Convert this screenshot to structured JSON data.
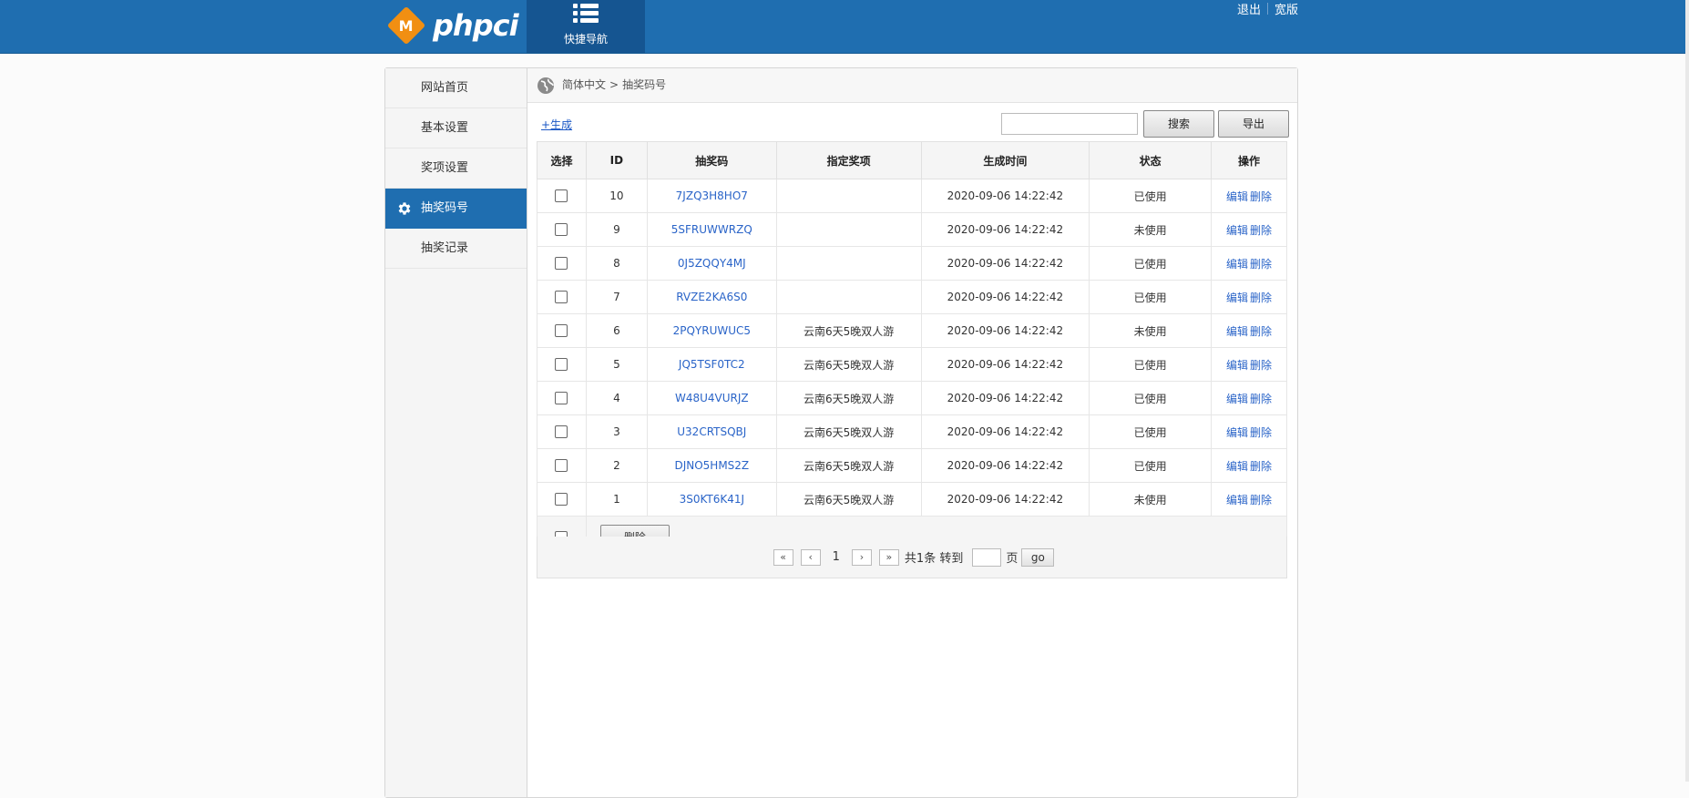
{
  "header": {
    "logo_mark": "M",
    "logo_text": "phpci",
    "quicknav_label": "快捷导航",
    "logout": "退出",
    "wide": "宽版"
  },
  "sidebar": {
    "items": [
      {
        "label": "网站首页"
      },
      {
        "label": "基本设置"
      },
      {
        "label": "奖项设置"
      },
      {
        "label": "抽奖码号",
        "active": true
      },
      {
        "label": "抽奖记录"
      }
    ]
  },
  "breadcrumb": {
    "root": "简体中文",
    "sep": ">",
    "current": "抽奖码号"
  },
  "toolbar": {
    "generate": "+生成",
    "search_value": "",
    "search_label": "搜索",
    "export_label": "导出"
  },
  "table": {
    "headers": [
      "选择",
      "ID",
      "抽奖码",
      "指定奖项",
      "生成时间",
      "状态",
      "操作"
    ],
    "edit_label": "编辑",
    "delete_label": "删除",
    "rows": [
      {
        "id": "10",
        "code": "7JZQ3H8HO7",
        "prize": "",
        "time": "2020-09-06 14:22:42",
        "status": "已使用"
      },
      {
        "id": "9",
        "code": "5SFRUWWRZQ",
        "prize": "",
        "time": "2020-09-06 14:22:42",
        "status": "未使用"
      },
      {
        "id": "8",
        "code": "0J5ZQQY4MJ",
        "prize": "",
        "time": "2020-09-06 14:22:42",
        "status": "已使用"
      },
      {
        "id": "7",
        "code": "RVZE2KA6S0",
        "prize": "",
        "time": "2020-09-06 14:22:42",
        "status": "已使用"
      },
      {
        "id": "6",
        "code": "2PQYRUWUC5",
        "prize": "云南6天5晚双人游",
        "time": "2020-09-06 14:22:42",
        "status": "未使用"
      },
      {
        "id": "5",
        "code": "JQ5TSF0TC2",
        "prize": "云南6天5晚双人游",
        "time": "2020-09-06 14:22:42",
        "status": "已使用"
      },
      {
        "id": "4",
        "code": "W48U4VURJZ",
        "prize": "云南6天5晚双人游",
        "time": "2020-09-06 14:22:42",
        "status": "已使用"
      },
      {
        "id": "3",
        "code": "U32CRTSQBJ",
        "prize": "云南6天5晚双人游",
        "time": "2020-09-06 14:22:42",
        "status": "已使用"
      },
      {
        "id": "2",
        "code": "DJNO5HMS2Z",
        "prize": "云南6天5晚双人游",
        "time": "2020-09-06 14:22:42",
        "status": "已使用"
      },
      {
        "id": "1",
        "code": "3S0KT6K41J",
        "prize": "云南6天5晚双人游",
        "time": "2020-09-06 14:22:42",
        "status": "未使用"
      }
    ],
    "bulk_delete": "删除"
  },
  "pager": {
    "first": "«",
    "prev": "‹",
    "current": "1",
    "next": "›",
    "last": "»",
    "total_text": "共1条 转到",
    "page_unit": "页",
    "go": "go"
  },
  "colors": {
    "header_bg": "#1f6eb0",
    "active_nav": "#1f6eb0",
    "link": "#2a64c8",
    "logo_orange": "#f18f12"
  }
}
